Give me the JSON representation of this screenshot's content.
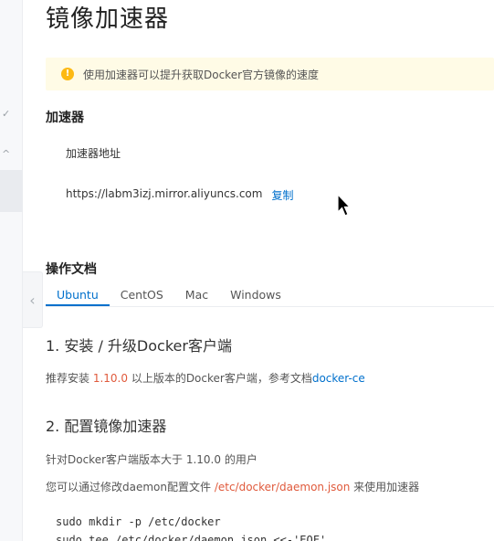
{
  "page": {
    "title": "镜像加速器"
  },
  "notice": {
    "icon": "warning-icon",
    "text": "使用加速器可以提升获取Docker官方镜像的速度",
    "color": "#fffbe6"
  },
  "accelerator": {
    "section_title": "加速器",
    "address_label": "加速器地址",
    "address_value": "https://labm3izj.mirror.aliyuncs.com",
    "copy_label": "复制"
  },
  "docs": {
    "section_title": "操作文档",
    "tabs": [
      {
        "label": "Ubuntu",
        "active": true
      },
      {
        "label": "CentOS",
        "active": false
      },
      {
        "label": "Mac",
        "active": false
      },
      {
        "label": "Windows",
        "active": false
      }
    ],
    "step1": {
      "title": "1. 安装 / 升级Docker客户端",
      "text_prefix": "推荐安装 ",
      "version": "1.10.0",
      "text_middle": " 以上版本的Docker客户端，参考文档",
      "link": "docker-ce"
    },
    "step2": {
      "title": "2. 配置镜像加速器",
      "line1": "针对Docker客户端版本大于 1.10.0 的用户",
      "line2_prefix": "您可以通过修改daemon配置文件 ",
      "config_path": "/etc/docker/daemon.json",
      "line2_suffix": " 来使用加速器"
    },
    "code": [
      "sudo mkdir -p /etc/docker",
      "sudo tee /etc/docker/daemon.json <<-'EOF'"
    ]
  },
  "colors": {
    "accent_blue": "#0070cc",
    "accent_orange": "#e05a3c",
    "warning": "#fdb913"
  }
}
